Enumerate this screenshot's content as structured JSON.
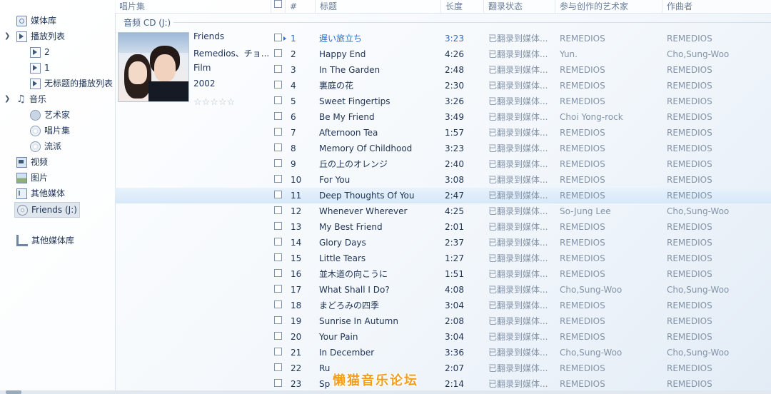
{
  "sidebar": {
    "library": "媒体库",
    "playlists": "播放列表",
    "playlist_items": [
      "2",
      "1",
      "无标题的播放列表"
    ],
    "music": "音乐",
    "music_items": [
      "艺术家",
      "唱片集",
      "流派"
    ],
    "video": "视频",
    "pictures": "图片",
    "other_media": "其他媒体",
    "cd": "Friends (J:)",
    "other_libraries": "其他媒体库"
  },
  "columns": {
    "album": "唱片集",
    "num": "#",
    "title": "标题",
    "duration": "长度",
    "rip_status": "翻录状态",
    "contributing_artist": "参与创作的艺术家",
    "composer": "作曲者"
  },
  "group_label": "音频 CD (J:)",
  "album": {
    "title": "Friends",
    "artist": "Remedios、チョ...",
    "genre": "Film",
    "year": "2002",
    "rating_stars": "☆☆☆☆☆",
    "rating": 0
  },
  "tracks": [
    {
      "num": "1",
      "title": "遅い旅立ち",
      "duration": "3:23",
      "rip": "已翻录到媒体...",
      "artist": "REMEDIOS",
      "composer": "REMEDIOS",
      "playing": true
    },
    {
      "num": "2",
      "title": "Happy End",
      "duration": "4:26",
      "rip": "已翻录到媒体...",
      "artist": "Yun.",
      "composer": "Cho,Sung-Woo"
    },
    {
      "num": "3",
      "title": "In The Garden",
      "duration": "2:48",
      "rip": "已翻录到媒体...",
      "artist": "REMEDIOS",
      "composer": "REMEDIOS"
    },
    {
      "num": "4",
      "title": "裏庭の花",
      "duration": "2:30",
      "rip": "已翻录到媒体...",
      "artist": "REMEDIOS",
      "composer": "REMEDIOS"
    },
    {
      "num": "5",
      "title": "Sweet Fingertips",
      "duration": "3:26",
      "rip": "已翻录到媒体...",
      "artist": "REMEDIOS",
      "composer": "REMEDIOS"
    },
    {
      "num": "6",
      "title": "Be My Friend",
      "duration": "3:49",
      "rip": "已翻录到媒体...",
      "artist": "Choi Yong-rock",
      "composer": "REMEDIOS"
    },
    {
      "num": "7",
      "title": "Afternoon Tea",
      "duration": "1:57",
      "rip": "已翻录到媒体...",
      "artist": "REMEDIOS",
      "composer": "REMEDIOS"
    },
    {
      "num": "8",
      "title": "Memory Of Childhood",
      "duration": "3:23",
      "rip": "已翻录到媒体...",
      "artist": "REMEDIOS",
      "composer": "REMEDIOS"
    },
    {
      "num": "9",
      "title": "丘の上のオレンジ",
      "duration": "2:40",
      "rip": "已翻录到媒体...",
      "artist": "REMEDIOS",
      "composer": "REMEDIOS"
    },
    {
      "num": "10",
      "title": "For You",
      "duration": "3:08",
      "rip": "已翻录到媒体...",
      "artist": "REMEDIOS",
      "composer": "REMEDIOS"
    },
    {
      "num": "11",
      "title": "Deep Thoughts Of You",
      "duration": "2:47",
      "rip": "已翻录到媒体...",
      "artist": "REMEDIOS",
      "composer": "REMEDIOS",
      "selected": true
    },
    {
      "num": "12",
      "title": "Whenever Wherever",
      "duration": "4:25",
      "rip": "已翻录到媒体...",
      "artist": "So-Jung Lee",
      "composer": "Cho,Sung-Woo"
    },
    {
      "num": "13",
      "title": "My Best Friend",
      "duration": "2:01",
      "rip": "已翻录到媒体...",
      "artist": "REMEDIOS",
      "composer": "REMEDIOS"
    },
    {
      "num": "14",
      "title": "Glory Days",
      "duration": "2:37",
      "rip": "已翻录到媒体...",
      "artist": "REMEDIOS",
      "composer": "REMEDIOS"
    },
    {
      "num": "15",
      "title": "Little Tears",
      "duration": "1:27",
      "rip": "已翻录到媒体...",
      "artist": "REMEDIOS",
      "composer": "REMEDIOS"
    },
    {
      "num": "16",
      "title": "並木道の向こうに",
      "duration": "1:51",
      "rip": "已翻录到媒体...",
      "artist": "REMEDIOS",
      "composer": "REMEDIOS"
    },
    {
      "num": "17",
      "title": "What Shall I Do?",
      "duration": "4:08",
      "rip": "已翻录到媒体...",
      "artist": "Cho,Sung-Woo",
      "composer": "Cho,Sung-Woo"
    },
    {
      "num": "18",
      "title": "まどろみの四季",
      "duration": "3:04",
      "rip": "已翻录到媒体...",
      "artist": "REMEDIOS",
      "composer": "REMEDIOS"
    },
    {
      "num": "19",
      "title": "Sunrise In Autumn",
      "duration": "2:08",
      "rip": "已翻录到媒体...",
      "artist": "REMEDIOS",
      "composer": "REMEDIOS"
    },
    {
      "num": "20",
      "title": "Your Pain",
      "duration": "3:04",
      "rip": "已翻录到媒体...",
      "artist": "REMEDIOS",
      "composer": "REMEDIOS"
    },
    {
      "num": "21",
      "title": "In December",
      "duration": "3:36",
      "rip": "已翻录到媒体...",
      "artist": "Cho,Sung-Woo",
      "composer": "Cho,Sung-Woo"
    },
    {
      "num": "22",
      "title": "Ru",
      "duration": "2:07",
      "rip": "已翻录到媒体...",
      "artist": "REMEDIOS",
      "composer": "REMEDIOS"
    },
    {
      "num": "23",
      "title": "Sp",
      "duration": "2:14",
      "rip": "已翻录到媒体...",
      "artist": "REMEDIOS",
      "composer": "REMEDIOS"
    }
  ],
  "watermark": "懒猫音乐论坛",
  "colors": {
    "accent": "#2a6fc9",
    "selection": "#d6e8f8",
    "watermark": "#f29d1c"
  }
}
